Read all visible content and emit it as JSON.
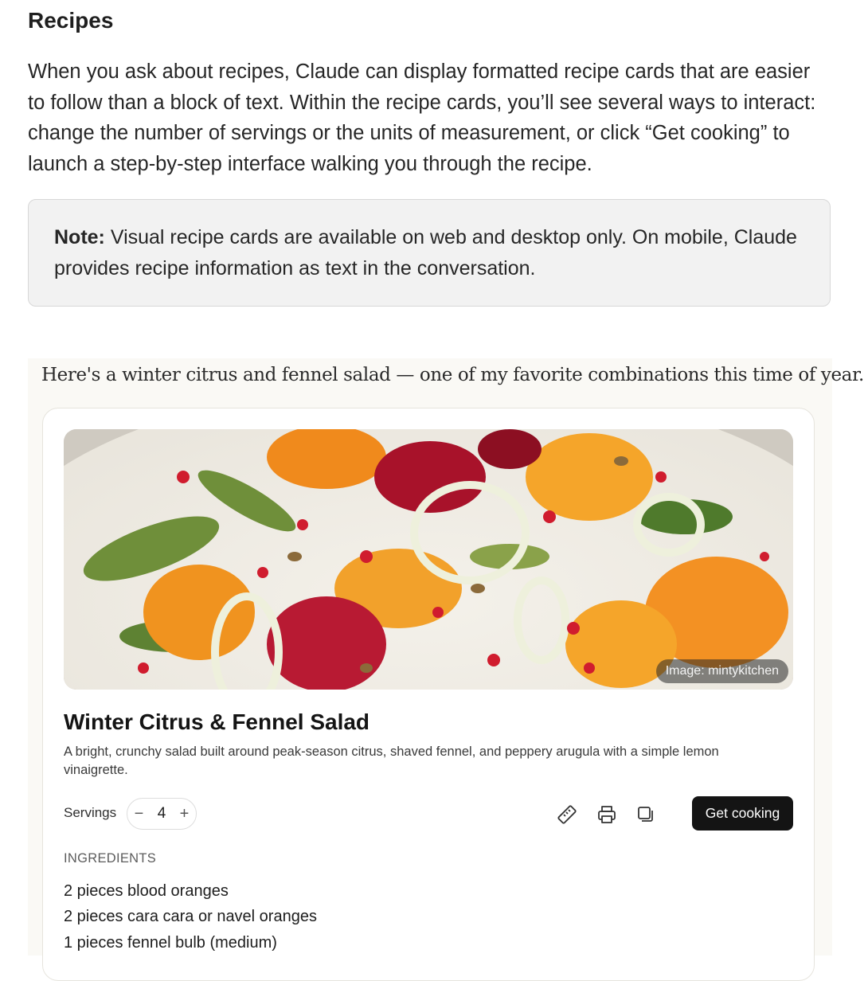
{
  "doc": {
    "heading": "Recipes",
    "intro": "When you ask about recipes, Claude can display formatted recipe cards that are easier to follow than a block of text. Within the recipe cards, you’ll see several ways to interact: change the number of servings or the units of measurement, or click “Get cooking” to launch a step-by-step interface walking you through the recipe.",
    "note_label": "Note:",
    "note_text": "Visual recipe cards are available on web and desktop only. On mobile, Claude provides recipe information as text in the conversation."
  },
  "chat": {
    "message": "Here's a winter citrus and fennel salad — one of my favorite combinations this time of year."
  },
  "recipe": {
    "image_credit": "Image: mintykitchen",
    "title": "Winter Citrus & Fennel Salad",
    "description": "A bright, crunchy salad built around peak-season citrus, shaved fennel, and peppery arugula with a simple lemon vinaigrette.",
    "servings_label": "Servings",
    "servings": "4",
    "decrement": "−",
    "increment": "+",
    "toolbar": {
      "units_icon": "ruler-icon",
      "print_icon": "printer-icon",
      "copy_icon": "copy-icon"
    },
    "cook_label": "Get cooking",
    "ingredients_heading": "INGREDIENTS",
    "ingredients": [
      "2 pieces blood oranges",
      "2 pieces cara cara or navel oranges",
      "1 pieces fennel bulb (medium)"
    ]
  },
  "colors": {
    "chat_bg": "#faf9f5",
    "note_bg": "#f2f2f2",
    "button_bg": "#141414"
  }
}
